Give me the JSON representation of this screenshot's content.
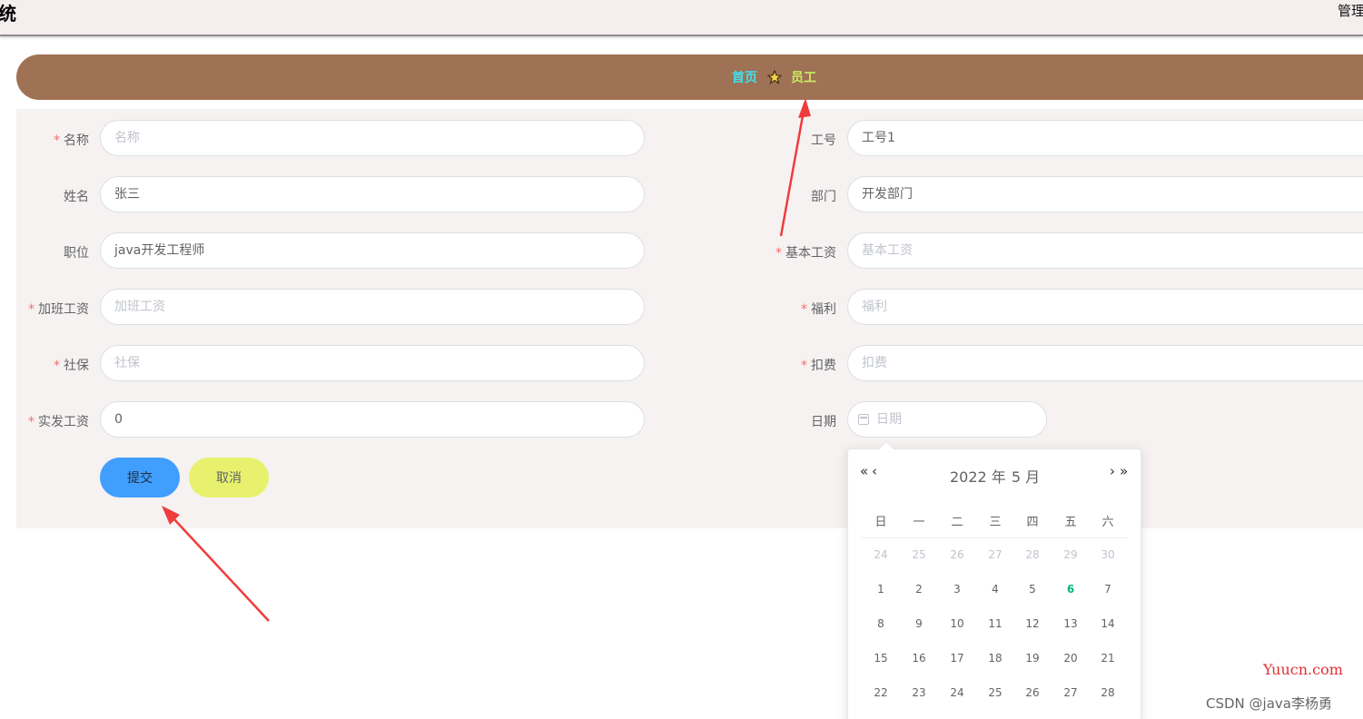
{
  "header": {
    "app_title": "统",
    "top_right": "管理"
  },
  "breadcrumb": {
    "home": "首页",
    "current": "员工"
  },
  "form": {
    "left": [
      {
        "label": "名称",
        "required": true,
        "value": "",
        "placeholder": "名称"
      },
      {
        "label": "姓名",
        "required": false,
        "value": "张三",
        "placeholder": ""
      },
      {
        "label": "职位",
        "required": false,
        "value": "java开发工程师",
        "placeholder": ""
      },
      {
        "label": "加班工资",
        "required": true,
        "value": "",
        "placeholder": "加班工资"
      },
      {
        "label": "社保",
        "required": true,
        "value": "",
        "placeholder": "社保"
      },
      {
        "label": "实发工资",
        "required": true,
        "value": "0",
        "placeholder": ""
      }
    ],
    "right": [
      {
        "label": "工号",
        "required": false,
        "value": "工号1",
        "placeholder": ""
      },
      {
        "label": "部门",
        "required": false,
        "value": "开发部门",
        "placeholder": ""
      },
      {
        "label": "基本工资",
        "required": true,
        "value": "",
        "placeholder": "基本工资"
      },
      {
        "label": "福利",
        "required": true,
        "value": "",
        "placeholder": "福利"
      },
      {
        "label": "扣费",
        "required": true,
        "value": "",
        "placeholder": "扣费"
      }
    ],
    "date": {
      "label": "日期",
      "required": false,
      "value": "",
      "placeholder": "日期"
    },
    "buttons": {
      "submit": "提交",
      "cancel": "取消"
    }
  },
  "date_picker": {
    "year": "2022 年",
    "month": "5 月",
    "nav": {
      "prev_year": "«",
      "prev_month": "‹",
      "next_month": "›",
      "next_year": "»"
    },
    "weekdays": [
      "日",
      "一",
      "二",
      "三",
      "四",
      "五",
      "六"
    ],
    "weeks": [
      [
        "24",
        "25",
        "26",
        "27",
        "28",
        "29",
        "30"
      ],
      [
        "1",
        "2",
        "3",
        "4",
        "5",
        "6",
        "7"
      ],
      [
        "8",
        "9",
        "10",
        "11",
        "12",
        "13",
        "14"
      ],
      [
        "15",
        "16",
        "17",
        "18",
        "19",
        "20",
        "21"
      ],
      [
        "22",
        "23",
        "24",
        "25",
        "26",
        "27",
        "28"
      ]
    ],
    "prev_month_row": 0,
    "today": "6"
  },
  "watermark": {
    "site": "Yuucn.com",
    "author": "CSDN @java李杨勇"
  },
  "colors": {
    "primary": "#409eff",
    "cancel": "#e7f16d",
    "breadcrumb_bar": "#9f7155",
    "required": "#f56c6c",
    "today": "#00b880",
    "annotation_arrow": "#f03c3c"
  },
  "icons": {
    "breadcrumb_separator": "star-icon",
    "date_prefix": "calendar-icon"
  }
}
